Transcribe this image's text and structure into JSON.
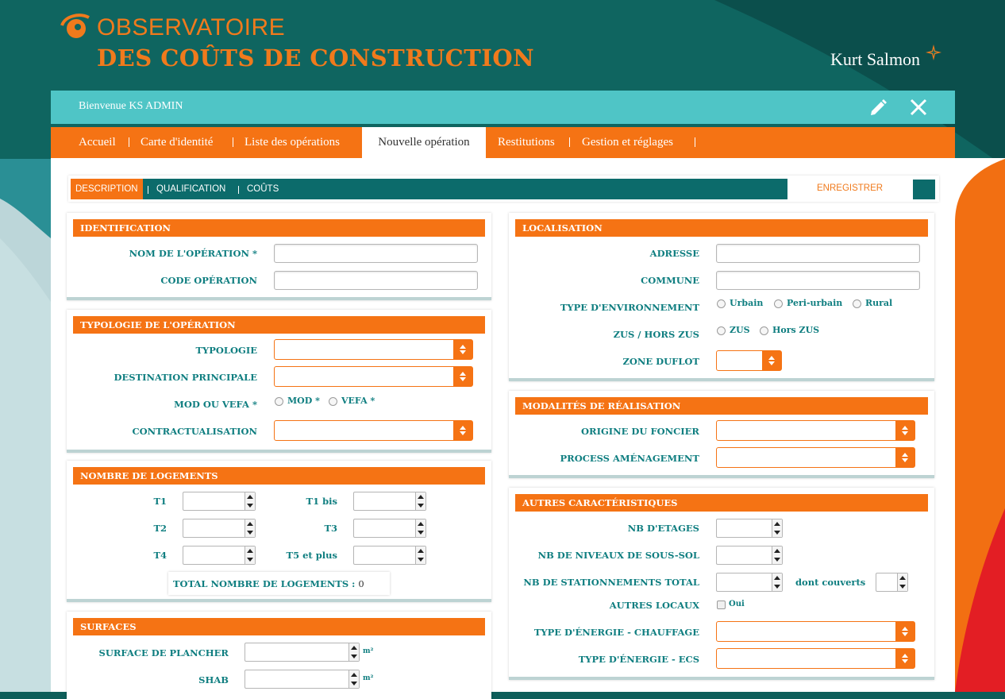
{
  "header": {
    "logo_line1": "OBSERVATOIRE",
    "logo_line2": "DES COÛTS DE CONSTRUCTION",
    "brand": "Kurt Salmon",
    "welcome": "Bienvenue KS ADMIN"
  },
  "colors": {
    "orange": "#f57314",
    "teal": "#0c6b6b",
    "light_teal": "#4fc5c6",
    "label_teal": "#0f7e80"
  },
  "icons": {
    "edit": "pencil-icon",
    "close": "close-icon",
    "logo": "eye-logo-icon",
    "brand": "star-icon"
  },
  "nav": {
    "items": [
      "Accueil",
      "Carte d'identité",
      "Liste des opérations",
      "Nouvelle opération",
      "Restitutions",
      "Gestion et réglages"
    ],
    "active": "Nouvelle opération"
  },
  "subnav": {
    "items": [
      "DESCRIPTION",
      "QUALIFICATION",
      "COÛTS"
    ],
    "active": "DESCRIPTION",
    "save": "ENREGISTRER"
  },
  "identification": {
    "title": "IDENTIFICATION",
    "name_label": "NOM DE L'OPÉRATION *",
    "code_label": "CODE OPÉRATION",
    "name_value": "",
    "code_value": ""
  },
  "typologie": {
    "title": "TYPOLOGIE DE L'OPÉRATION",
    "typologie_label": "TYPOLOGIE",
    "destination_label": "DESTINATION PRINCIPALE",
    "mod_vefa_label": "MOD OU VEFA *",
    "mod_option": "MOD *",
    "vefa_option": "VEFA *",
    "contract_label": "CONTRACTUALISATION"
  },
  "logements": {
    "title": "NOMBRE DE LOGEMENTS",
    "t1": "T1",
    "t1bis": "T1 bis",
    "t2": "T2",
    "t3": "T3",
    "t4": "T4",
    "t5": "T5 et plus",
    "total_label": "TOTAL NOMBRE DE LOGEMENTS :",
    "total_value": "0"
  },
  "surfaces": {
    "title": "SURFACES",
    "plancher_label": "SURFACE DE PLANCHER",
    "shab_label": "SHAB",
    "unit": "m²"
  },
  "localisation": {
    "title": "LOCALISATION",
    "adresse_label": "ADRESSE",
    "commune_label": "COMMUNE",
    "env_label": "TYPE D'ENVIRONNEMENT",
    "env_options": [
      "Urbain",
      "Peri-urbain",
      "Rural"
    ],
    "zus_label": "ZUS / HORS ZUS",
    "zus_options": [
      "ZUS",
      "Hors ZUS"
    ],
    "duflot_label": "ZONE DUFLOT"
  },
  "modalites": {
    "title": "MODALITÉS DE RÉALISATION",
    "foncier_label": "ORIGINE DU FONCIER",
    "process_label": "PROCESS AMÉNAGEMENT"
  },
  "autres": {
    "title": "AUTRES CARACTÉRISTIQUES",
    "etages_label": "NB D'ETAGES",
    "sous_sol_label": "NB DE NIVEAUX DE SOUS-SOL",
    "stationnements_label": "NB DE STATIONNEMENTS TOTAL",
    "couverts_label": "dont couverts",
    "locaux_label": "AUTRES LOCAUX",
    "oui_label": "Oui",
    "chauffage_label": "TYPE D'ÉNERGIE - CHAUFFAGE",
    "ecs_label": "TYPE D'ÉNERGIE - ECS"
  }
}
